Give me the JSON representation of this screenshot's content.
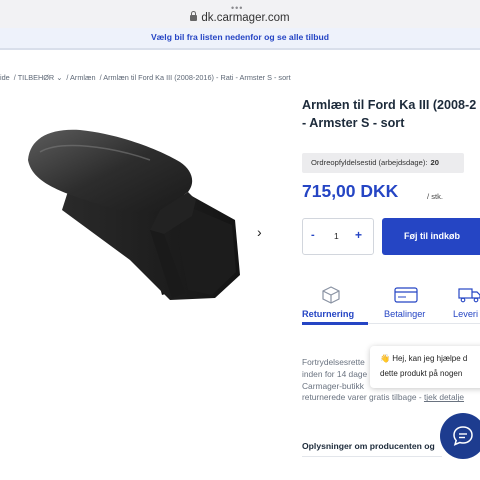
{
  "browser": {
    "url": "dk.carmager.com"
  },
  "banner": {
    "text": "Vælg bil fra listen nedenfor og se alle tilbud"
  },
  "breadcrumb": {
    "items": [
      "ide",
      "/ TILBEHØR ⌄",
      "/ Armlæn",
      "/ Armlæn til Ford Ka III (2008-2016) - Rati - Armster S - sort"
    ]
  },
  "product": {
    "title_line1": "Armlæn til Ford Ka III (2008-2",
    "title_line2": "- Armster S - sort",
    "delivery_label": "Ordreopfyldelsestid (arbejdsdage):",
    "delivery_value": "20",
    "price": "715,00 DKK",
    "per_unit": "/ stk.",
    "quantity": "1",
    "minus_label": "-",
    "plus_label": "+",
    "add_to_cart_label": "Føj til indkøb"
  },
  "tabs": [
    {
      "label": "Returnering",
      "icon": "package-icon",
      "active": true
    },
    {
      "label": "Betalinger",
      "icon": "card-icon",
      "active": false
    },
    {
      "label": "Leveri",
      "icon": "truck-icon",
      "active": false
    }
  ],
  "returns": {
    "line1": "Fortrydelsesrette",
    "line2": "inden for 14 dage",
    "line3": "Carmager-butikk",
    "line4": "returnerede varer gratis tilbage - ",
    "link": "tjek detalje"
  },
  "chat": {
    "line1": "Hej, kan jeg hjælpe d",
    "line2": "dette produkt på nogen"
  },
  "info": {
    "heading": "Oplysninger om producenten og"
  },
  "colors": {
    "brand_blue": "#2545c4",
    "chat_button": "#1d3c8f"
  }
}
